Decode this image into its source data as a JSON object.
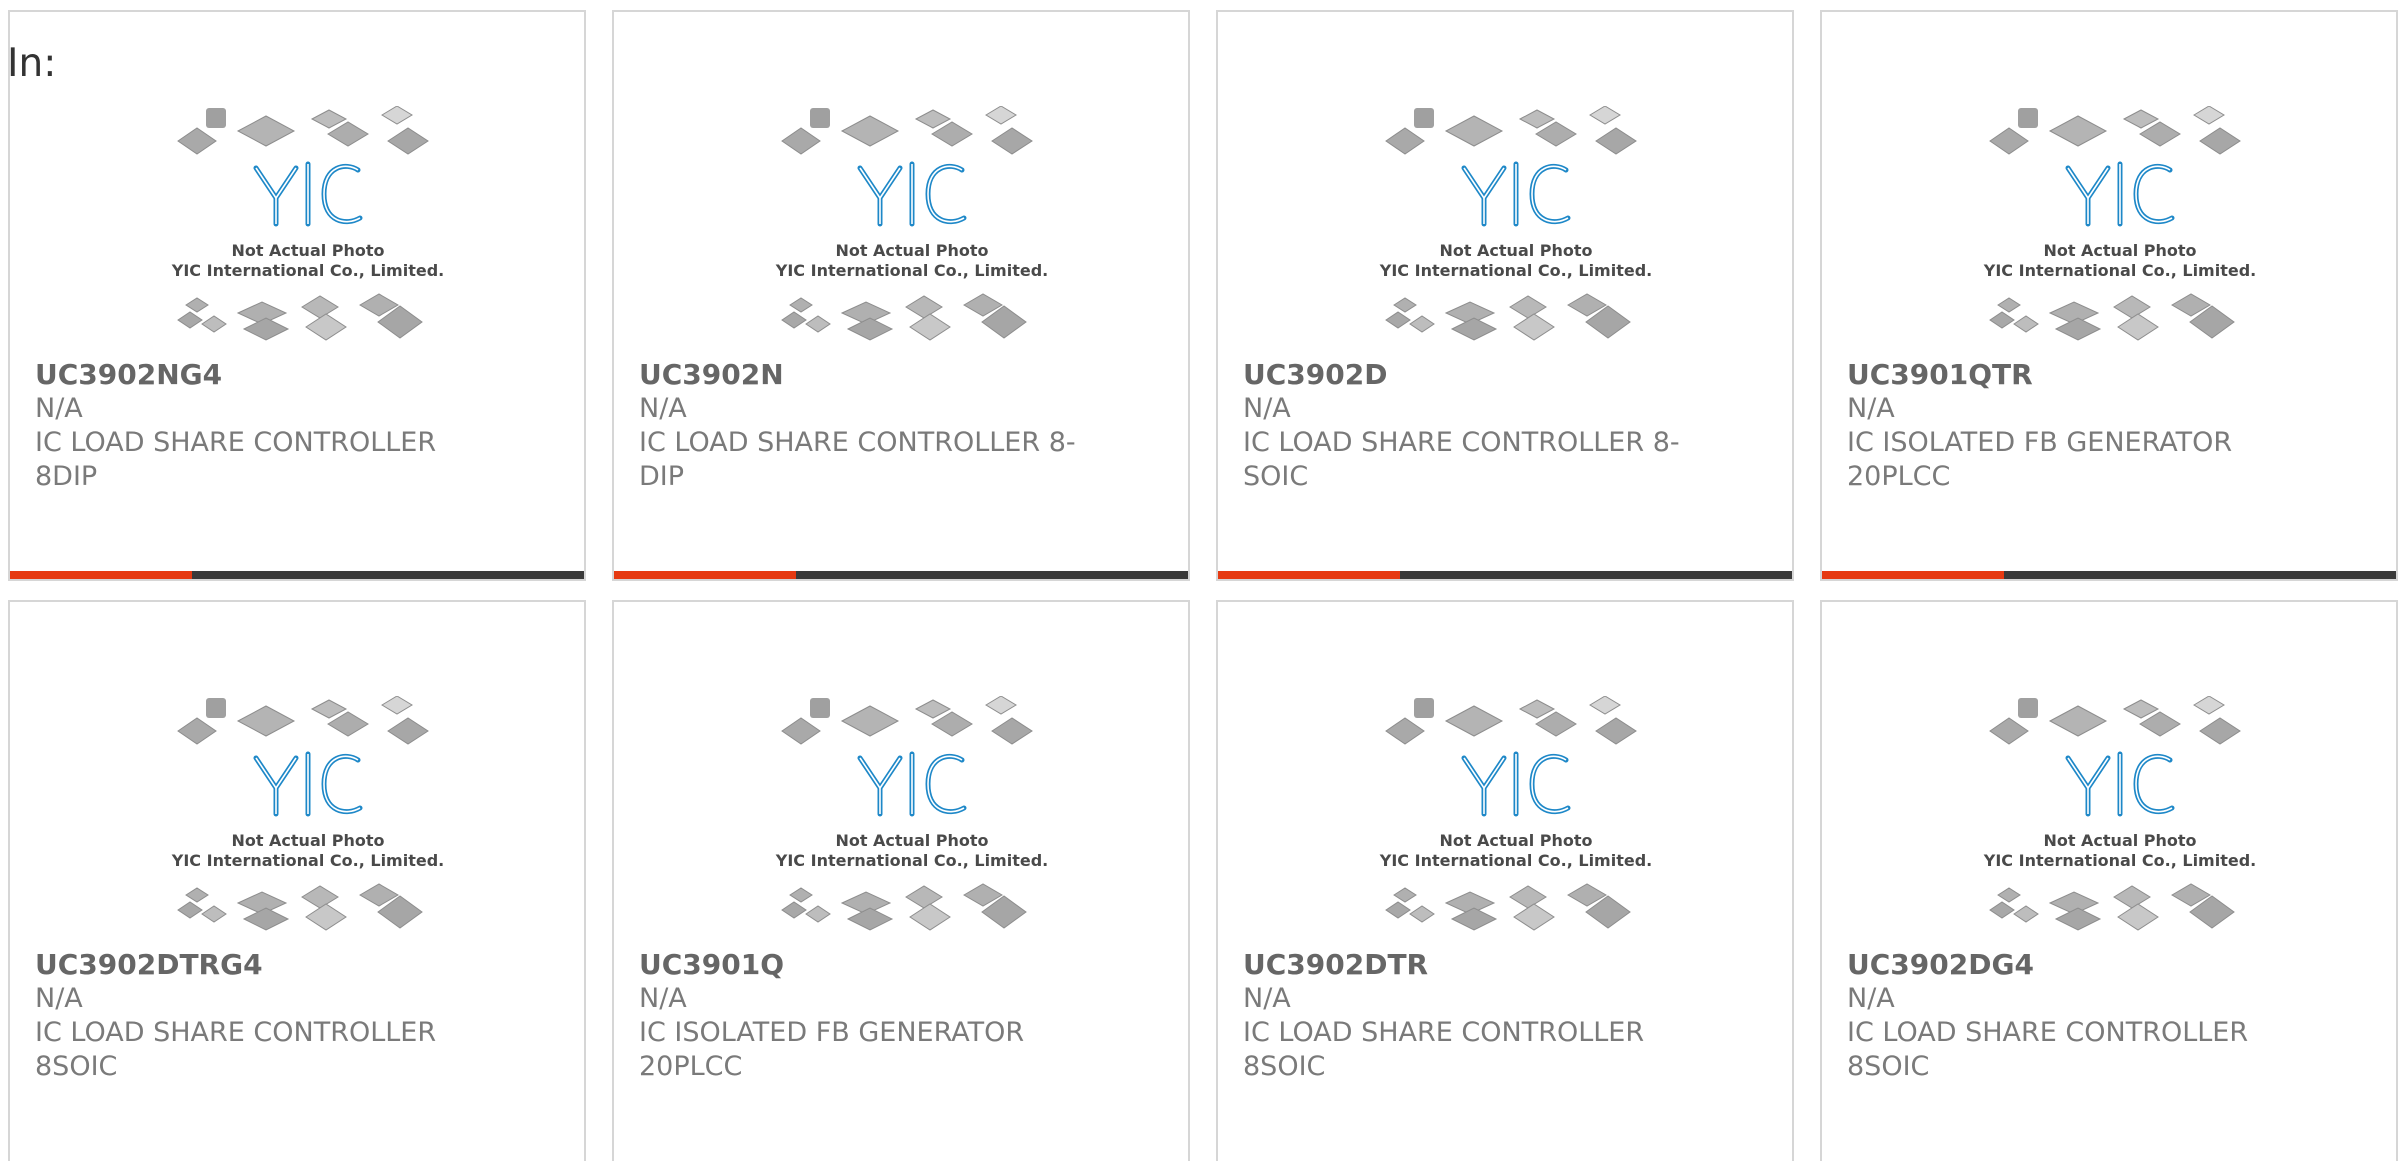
{
  "header": {
    "label": "In:"
  },
  "placeholder": {
    "line1": "Not Actual Photo",
    "line2": "YIC International Co., Limited.",
    "logo": "YIC"
  },
  "products": [
    {
      "part": "UC3902NG4",
      "status": "N/A",
      "desc_line1": "IC LOAD SHARE CONTROLLER",
      "desc_line2": "8DIP"
    },
    {
      "part": "UC3902N",
      "status": "N/A",
      "desc_line1": "IC LOAD SHARE CONTROLLER 8-",
      "desc_line2": "DIP"
    },
    {
      "part": "UC3902D",
      "status": "N/A",
      "desc_line1": "IC LOAD SHARE CONTROLLER 8-",
      "desc_line2": "SOIC"
    },
    {
      "part": "UC3901QTR",
      "status": "N/A",
      "desc_line1": "IC ISOLATED FB GENERATOR",
      "desc_line2": "20PLCC"
    },
    {
      "part": "UC3902DTRG4",
      "status": "N/A",
      "desc_line1": "IC LOAD SHARE CONTROLLER",
      "desc_line2": "8SOIC"
    },
    {
      "part": "UC3901Q",
      "status": "N/A",
      "desc_line1": "IC ISOLATED FB GENERATOR",
      "desc_line2": "20PLCC"
    },
    {
      "part": "UC3902DTR",
      "status": "N/A",
      "desc_line1": "IC LOAD SHARE CONTROLLER",
      "desc_line2": "8SOIC"
    },
    {
      "part": "UC3902DG4",
      "status": "N/A",
      "desc_line1": "IC LOAD SHARE CONTROLLER",
      "desc_line2": "8SOIC"
    }
  ],
  "colors": {
    "accent": "#e63a12",
    "bar": "#3a3a3a",
    "logo_blue": "#1e88c8"
  }
}
